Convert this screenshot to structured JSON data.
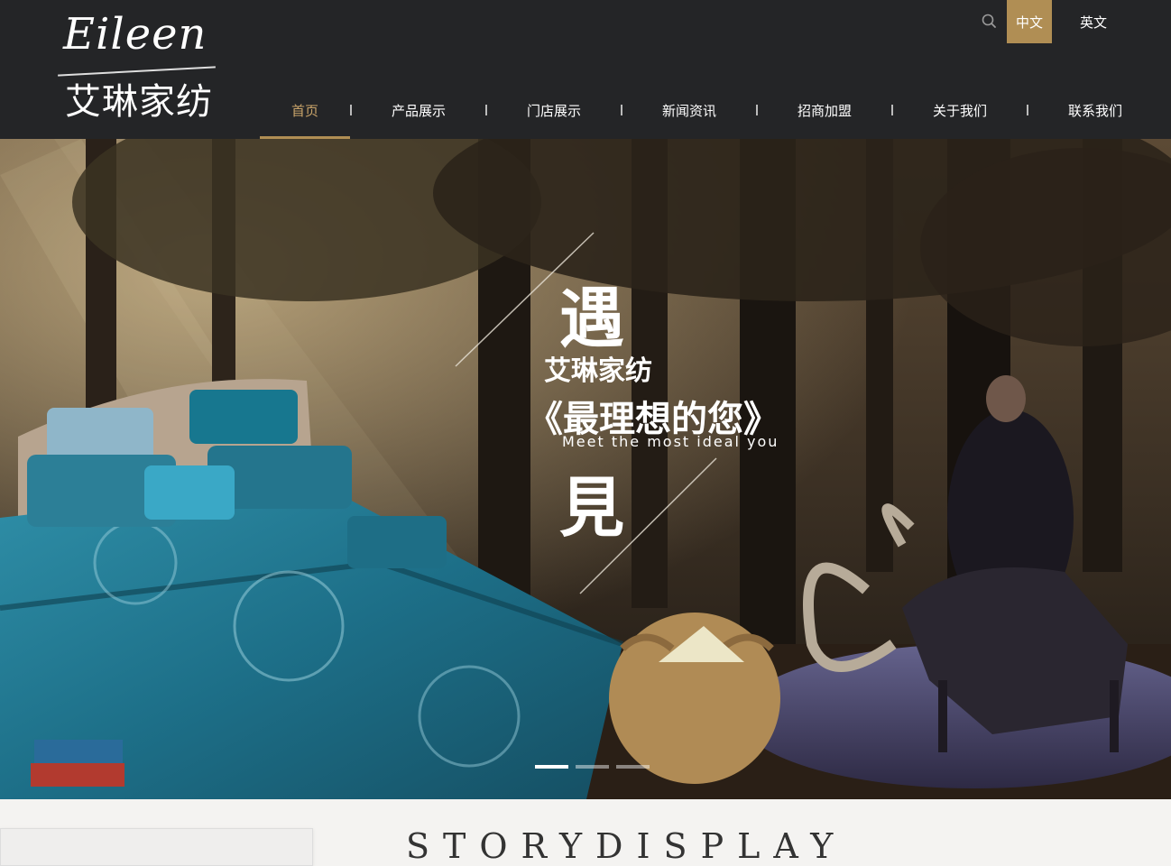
{
  "header": {
    "logo": {
      "script": "Eileen",
      "cn": "艾琳家纺"
    },
    "lang": {
      "cn": "中文",
      "en": "英文"
    },
    "nav": [
      {
        "label": "首页",
        "active": true
      },
      {
        "label": "产品展示"
      },
      {
        "label": "门店展示"
      },
      {
        "label": "新闻资讯"
      },
      {
        "label": "招商加盟"
      },
      {
        "label": "关于我们"
      },
      {
        "label": "联系我们"
      }
    ]
  },
  "banner": {
    "line1": "遇",
    "line2": "艾琳家纺",
    "line3": "《最理想的您》",
    "line4": "Meet the most ideal you",
    "line5": "見",
    "slides": {
      "count": 3,
      "active": 1
    }
  },
  "section": {
    "title": "STORYDISPLAY"
  },
  "colors": {
    "header_bg": "#242527",
    "accent": "#b08e54"
  }
}
